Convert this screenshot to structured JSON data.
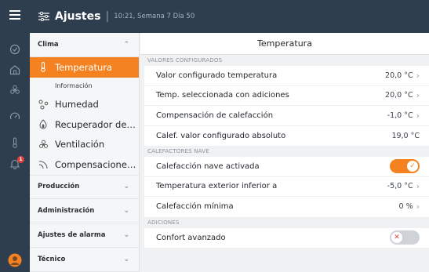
{
  "header": {
    "title": "Ajustes",
    "subtitle": "10:21, Semana 7 Día 50"
  },
  "rail": {
    "icons": [
      "menu-icon",
      "alarm-list-icon",
      "house-icon",
      "fan-icon",
      "gauge-icon",
      "thermometer-icon",
      "bell-icon",
      "user-avatar"
    ],
    "bell_badge": "1"
  },
  "menu": {
    "sections": [
      {
        "label": "Clima",
        "expanded": true
      },
      {
        "label": "Producción"
      },
      {
        "label": "Administración"
      },
      {
        "label": "Ajustes de alarma"
      },
      {
        "label": "Técnico"
      }
    ],
    "clima_items": [
      {
        "label": "Temperatura",
        "icon": "thermometer-icon",
        "active": true
      },
      {
        "label": "Información",
        "sub": true
      },
      {
        "label": "Humedad",
        "icon": "humidity-icon"
      },
      {
        "label": "Recuperador de calor",
        "icon": "heat-recovery-icon"
      },
      {
        "label": "Ventilación",
        "icon": "fan-icon"
      },
      {
        "label": "Compensaciones del...",
        "icon": "compensation-icon"
      }
    ]
  },
  "main": {
    "title": "Temperatura",
    "groups": [
      {
        "label": "VALORES CONFIGURADOS",
        "rows": [
          {
            "label": "Valor configurado temperatura",
            "value": "20,0 °C",
            "arrow": true
          },
          {
            "label": "Temp. seleccionada con adiciones",
            "value": "20,0 °C",
            "arrow": true
          },
          {
            "label": "Compensación de calefacción",
            "value": "-1,0 °C",
            "arrow": true
          },
          {
            "label": "Calef. valor configurado absoluto",
            "value": "19,0 °C",
            "arrow": false
          }
        ]
      },
      {
        "label": "CALEFACTORES NAVE",
        "rows": [
          {
            "label": "Calefacción nave activada",
            "toggle": "on"
          },
          {
            "label": "Temperatura exterior inferior a",
            "value": "-5,0 °C",
            "arrow": true
          },
          {
            "label": "Calefacción mínima",
            "value": "0 %",
            "arrow": true
          }
        ]
      },
      {
        "label": "ADICIONES",
        "rows": [
          {
            "label": "Confort avanzado",
            "toggle": "off"
          }
        ]
      }
    ]
  },
  "colors": {
    "accent": "#f58220",
    "dark": "#2f3e4e",
    "badge": "#e2423b"
  }
}
